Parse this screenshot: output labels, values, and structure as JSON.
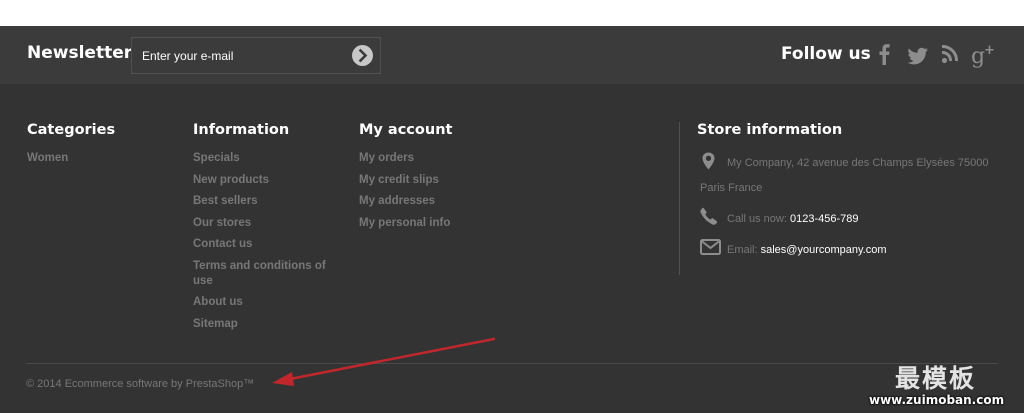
{
  "newsletter": {
    "title": "Newsletter",
    "placeholder": "Enter your e-mail"
  },
  "follow": {
    "title": "Follow us",
    "icons": [
      "facebook-icon",
      "twitter-icon",
      "rss-icon",
      "google-plus-icon"
    ]
  },
  "categories": {
    "title": "Categories",
    "items": [
      "Women"
    ]
  },
  "information": {
    "title": "Information",
    "items": [
      "Specials",
      "New products",
      "Best sellers",
      "Our stores",
      "Contact us",
      "Terms and conditions of use",
      "About us",
      "Sitemap"
    ]
  },
  "account": {
    "title": "My account",
    "items": [
      "My orders",
      "My credit slips",
      "My addresses",
      "My personal info"
    ]
  },
  "store": {
    "title": "Store information",
    "address_line1": "My Company, 42 avenue des Champs Elysées 75000",
    "address_line2": "Paris France",
    "call_label": "Call us now:",
    "phone": "0123-456-789",
    "email_label": "Email:",
    "email": "sales@yourcompany.com"
  },
  "copyright": "© 2014 Ecommerce software by PrestaShop™",
  "watermark": {
    "logo_text": "最模板",
    "url": "www.zuimoban.com"
  },
  "colors": {
    "bar_bg": "#3c3b3b",
    "footer_bg": "#333333",
    "link": "#777777",
    "annotation_arrow": "#c0272d"
  }
}
